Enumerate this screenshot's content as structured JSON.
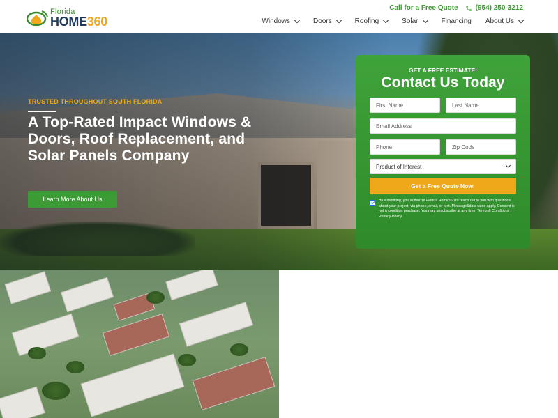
{
  "brand": {
    "name_top": "Florida",
    "name_main": "HOME",
    "name_num": "360"
  },
  "topbar": {
    "quote_link": "Call for a Free Quote",
    "phone": "(954) 250-3212"
  },
  "nav": {
    "items": [
      "Windows",
      "Doors",
      "Roofing",
      "Solar",
      "Financing",
      "About Us"
    ]
  },
  "hero": {
    "tagline": "TRUSTED THROUGHOUT SOUTH FLORIDA",
    "headline": "A Top-Rated Impact Windows & Doors, Roof Replacement, and Solar Panels Company",
    "cta": "Learn More About Us"
  },
  "form": {
    "eyebrow": "GET A FREE ESTIMATE!",
    "title": "Contact Us Today",
    "first_name": "First Name",
    "last_name": "Last Name",
    "email": "Email Address",
    "phone": "Phone",
    "zip": "Zip Code",
    "product": "Product of Interest",
    "submit": "Get a Free Quote Now!",
    "consent": "By submitting, you authorize Florida Home360 to reach out to you with questions about your project, via phone, email, or text. Message&data rates apply. Consent is not a condition purchase. You may unsubscribe at any time. Terms & Conditions | Privacy Policy"
  },
  "colors": {
    "green": "#3c9b34",
    "orange": "#f0a81b",
    "navy": "#1e3a5c"
  }
}
